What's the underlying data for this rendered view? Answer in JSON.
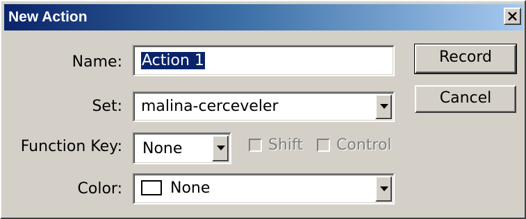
{
  "window": {
    "title": "New Action"
  },
  "form": {
    "name_label": "Name:",
    "name_value": "Action 1",
    "set_label": "Set:",
    "set_value": "malina-cerceveler",
    "function_key_label": "Function Key:",
    "function_key_value": "None",
    "shift_label": "Shift",
    "shift_checked": false,
    "control_label": "Control",
    "control_checked": false,
    "color_label": "Color:",
    "color_value": "None",
    "color_swatch": "#ffffff"
  },
  "buttons": {
    "record": "Record",
    "cancel": "Cancel"
  },
  "icons": {
    "close": "close-icon",
    "dropdown": "chevron-down-icon"
  },
  "colors": {
    "title_gradient_start": "#0a246a",
    "title_gradient_end": "#a6caf0",
    "dialog_bg": "#d4d0c8",
    "selection_bg": "#0a246a"
  }
}
